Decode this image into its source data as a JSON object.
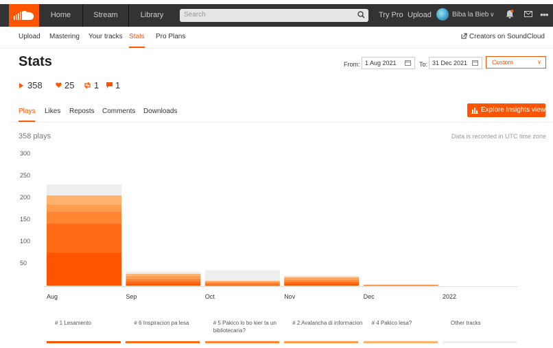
{
  "topbar": {
    "nav": [
      "Home",
      "Stream",
      "Library"
    ],
    "search_placeholder": "Search",
    "try_pro": "Try Pro",
    "upload": "Upload",
    "user": "Biba la Bieb",
    "caret": "∨",
    "more": "•••"
  },
  "subnav": {
    "items": [
      "Upload",
      "Mastering",
      "Your tracks",
      "Stats",
      "Pro Plans"
    ],
    "active": "Stats",
    "creators": "Creators on SoundCloud"
  },
  "header": {
    "title": "Stats",
    "from_label": "From:",
    "from_value": "1 Aug 2021",
    "to_label": "To:",
    "to_value": "31 Dec 2021",
    "range_select": "Custom"
  },
  "summary": {
    "plays": "358",
    "likes": "25",
    "reposts": "1",
    "comments": "1"
  },
  "tabs": {
    "items": [
      "Plays",
      "Likes",
      "Reposts",
      "Comments",
      "Downloads"
    ],
    "active": "Plays",
    "insights_button": "Explore Insights view"
  },
  "chart_info": {
    "plays_label": "358 plays",
    "utc_note": "Data is recorded in UTC time zone"
  },
  "colors": {
    "accent": "#ff5500",
    "topbar": "#333333",
    "other_tracks": "#eeeeee"
  },
  "chart_data": {
    "type": "bar",
    "stacked": true,
    "categories": [
      "Aug",
      "Sep",
      "Oct",
      "Nov",
      "Dec",
      "2022"
    ],
    "yticks": [
      50,
      100,
      150,
      200,
      250,
      300
    ],
    "ylim": [
      0,
      320
    ],
    "series": [
      {
        "name": "# 1 Lesamento",
        "color": "#ff5500",
        "values": [
          75,
          5,
          2,
          4,
          1,
          0
        ]
      },
      {
        "name": "# 6 Inspiracion pa lesa",
        "color": "#ff6a14",
        "values": [
          67,
          5,
          2,
          5,
          1,
          0
        ]
      },
      {
        "name": "# 5 Pakico lo bo kier ta un bibliotecaria?",
        "color": "#ff8533",
        "values": [
          28,
          6,
          3,
          4,
          0,
          0
        ]
      },
      {
        "name": "# 2 Avalancha di informacion",
        "color": "#ff9d4d",
        "values": [
          15,
          6,
          2,
          4,
          0,
          0
        ]
      },
      {
        "name": "# 4 Pakico lesa?",
        "color": "#ffb26e",
        "values": [
          21,
          5,
          2,
          3,
          0,
          0
        ]
      },
      {
        "name": "Other tracks",
        "color": "#eeeeee",
        "values": [
          25,
          5,
          24,
          3,
          1,
          0
        ]
      }
    ]
  }
}
